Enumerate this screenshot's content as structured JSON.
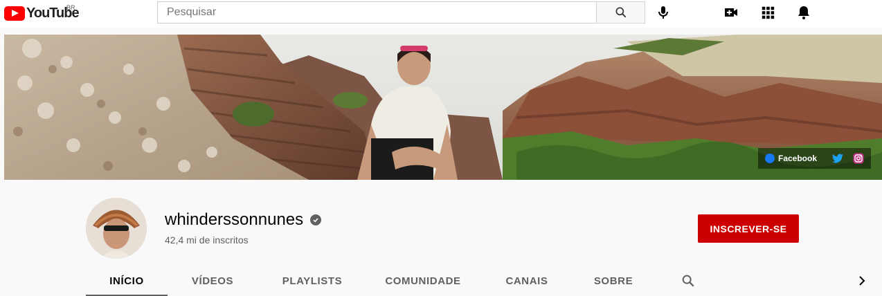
{
  "header": {
    "logo_text": "YouTube",
    "country_code": "BR",
    "search_placeholder": "Pesquisar",
    "icons": [
      "search-icon",
      "microphone-icon",
      "create-video-icon",
      "apps-grid-icon",
      "notifications-bell-icon"
    ]
  },
  "banner": {
    "links": [
      {
        "label": "Facebook",
        "icon": "facebook-icon"
      },
      {
        "label": "",
        "icon": "twitter-icon"
      },
      {
        "label": "",
        "icon": "instagram-icon"
      }
    ]
  },
  "channel": {
    "name": "whinderssonnunes",
    "subscribers": "42,4 mi de inscritos",
    "subscribe_label": "INSCREVER-SE"
  },
  "tabs": [
    {
      "label": "INÍCIO",
      "active": true
    },
    {
      "label": "VÍDEOS"
    },
    {
      "label": "PLAYLISTS"
    },
    {
      "label": "COMUNIDADE"
    },
    {
      "label": "CANAIS"
    },
    {
      "label": "SOBRE"
    }
  ],
  "colors": {
    "brand_red": "#ff0000",
    "subscribe_red": "#cc0000",
    "background": "#f9f9f9"
  }
}
